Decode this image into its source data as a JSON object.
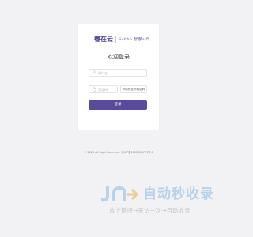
{
  "brand": {
    "logo_text": "睿在云",
    "slogan": "Sahbo 智慧+云"
  },
  "login": {
    "title": "欢迎登录",
    "username_placeholder": "用户名",
    "code_placeholder": "验证码",
    "get_code_label": "获取验证码验证码",
    "submit_label": "登录"
  },
  "footer": {
    "copyright": "© 2023 All Right Reserved.",
    "icp": "京ICP备2022008773号-1"
  },
  "watermark": {
    "title": "自动秒收录",
    "subtitle": "放上链接→来访一次→自动收录"
  },
  "colors": {
    "accent": "#5a4a9c",
    "background": "#f2f2f4",
    "card": "#ffffff",
    "watermark_blue": "#7fb3e0"
  }
}
